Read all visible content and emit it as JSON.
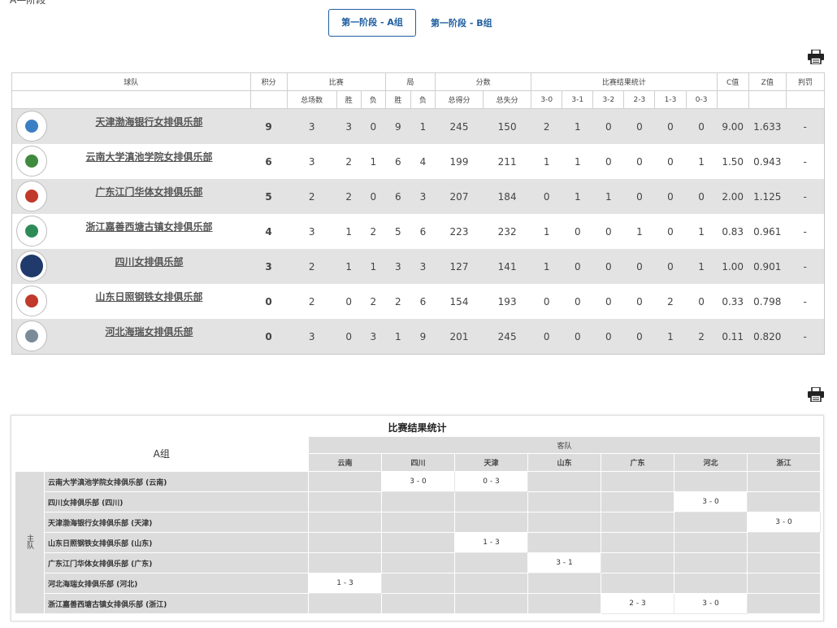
{
  "top_fragment": "A—阶段",
  "tabs": [
    {
      "label": "第一阶段 - A组",
      "active": true
    },
    {
      "label": "第一阶段 - B组",
      "active": false
    }
  ],
  "icons": {
    "print": "printer-icon"
  },
  "standings": {
    "headers_top": [
      "球队",
      "积分",
      "比赛",
      "局",
      "分数",
      "比赛结果统计",
      "C值",
      "Z值",
      "判罚"
    ],
    "headers_sub": [
      "总场数",
      "胜",
      "负",
      "胜",
      "负",
      "总得分",
      "总失分",
      "3-0",
      "3-1",
      "3-2",
      "2-3",
      "1-3",
      "0-3"
    ],
    "rows": [
      {
        "team": "天津渤海银行女排俱乐部",
        "pts": "9",
        "played": "3",
        "w": "3",
        "l": "0",
        "sw": "9",
        "sl": "1",
        "pf": "245",
        "pa": "150",
        "r30": "2",
        "r31": "1",
        "r32": "0",
        "r23": "0",
        "r13": "0",
        "r03": "0",
        "c": "9.00",
        "z": "1.633",
        "pen": "-",
        "logo_color": "#3a7fc4"
      },
      {
        "team": "云南大学滇池学院女排俱乐部",
        "pts": "6",
        "played": "3",
        "w": "2",
        "l": "1",
        "sw": "6",
        "sl": "4",
        "pf": "199",
        "pa": "211",
        "r30": "1",
        "r31": "1",
        "r32": "0",
        "r23": "0",
        "r13": "0",
        "r03": "1",
        "c": "1.50",
        "z": "0.943",
        "pen": "-",
        "logo_color": "#3f8a3f"
      },
      {
        "team": "广东江门华体女排俱乐部",
        "pts": "5",
        "played": "2",
        "w": "2",
        "l": "0",
        "sw": "6",
        "sl": "3",
        "pf": "207",
        "pa": "184",
        "r30": "0",
        "r31": "1",
        "r32": "1",
        "r23": "0",
        "r13": "0",
        "r03": "0",
        "c": "2.00",
        "z": "1.125",
        "pen": "-",
        "logo_color": "#c0392b"
      },
      {
        "team": "浙江嘉善西塘古镇女排俱乐部",
        "pts": "4",
        "played": "3",
        "w": "1",
        "l": "2",
        "sw": "5",
        "sl": "6",
        "pf": "223",
        "pa": "232",
        "r30": "1",
        "r31": "0",
        "r32": "0",
        "r23": "1",
        "r13": "0",
        "r03": "1",
        "c": "0.83",
        "z": "0.961",
        "pen": "-",
        "logo_color": "#2e8b57"
      },
      {
        "team": "四川女排俱乐部",
        "pts": "3",
        "played": "2",
        "w": "1",
        "l": "1",
        "sw": "3",
        "sl": "3",
        "pf": "127",
        "pa": "141",
        "r30": "1",
        "r31": "0",
        "r32": "0",
        "r23": "0",
        "r13": "0",
        "r03": "1",
        "c": "1.00",
        "z": "0.901",
        "pen": "-",
        "logo_color": "#1f3a6b"
      },
      {
        "team": "山东日照钢铁女排俱乐部",
        "pts": "0",
        "played": "2",
        "w": "0",
        "l": "2",
        "sw": "2",
        "sl": "6",
        "pf": "154",
        "pa": "193",
        "r30": "0",
        "r31": "0",
        "r32": "0",
        "r23": "0",
        "r13": "2",
        "r03": "0",
        "c": "0.33",
        "z": "0.798",
        "pen": "-",
        "logo_color": "#c0392b"
      },
      {
        "team": "河北海瑞女排俱乐部",
        "pts": "0",
        "played": "3",
        "w": "0",
        "l": "3",
        "sw": "1",
        "sl": "9",
        "pf": "201",
        "pa": "245",
        "r30": "0",
        "r31": "0",
        "r32": "0",
        "r23": "0",
        "r13": "1",
        "r03": "2",
        "c": "0.11",
        "z": "0.820",
        "pen": "-",
        "logo_color": "#7a8a99"
      }
    ]
  },
  "matrix": {
    "title": "比赛结果统计",
    "group": "A组",
    "visitor_label": "客队",
    "host_label": "主队",
    "columns": [
      "云南",
      "四川",
      "天津",
      "山东",
      "广东",
      "河北",
      "浙江"
    ],
    "rows": [
      {
        "label": "云南大学滇池学院女排俱乐部 (云南)",
        "cells": [
          "",
          "3 - 0",
          "0 - 3",
          "",
          "",
          "",
          ""
        ]
      },
      {
        "label": "四川女排俱乐部 (四川)",
        "cells": [
          "",
          "",
          "",
          "",
          "",
          "3 - 0",
          ""
        ]
      },
      {
        "label": "天津渤海银行女排俱乐部 (天津)",
        "cells": [
          "",
          "",
          "",
          "",
          "",
          "",
          "3 - 0"
        ]
      },
      {
        "label": "山东日照钢铁女排俱乐部 (山东)",
        "cells": [
          "",
          "",
          "1 - 3",
          "",
          "",
          "",
          ""
        ]
      },
      {
        "label": "广东江门华体女排俱乐部 (广东)",
        "cells": [
          "",
          "",
          "",
          "3 - 1",
          "",
          "",
          ""
        ]
      },
      {
        "label": "河北海瑞女排俱乐部 (河北)",
        "cells": [
          "1 - 3",
          "",
          "",
          "",
          "",
          "",
          ""
        ]
      },
      {
        "label": "浙江嘉善西塘古镇女排俱乐部 (浙江)",
        "cells": [
          "",
          "",
          "",
          "",
          "2 - 3",
          "3 - 0",
          ""
        ]
      }
    ]
  }
}
